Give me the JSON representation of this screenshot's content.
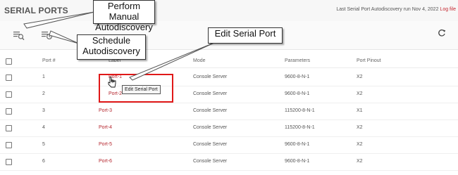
{
  "header": {
    "title": "SERIAL PORTS",
    "last_run_text": "Last Serial Port Autodiscovery run Nov 4, 2022",
    "log_file_link": "Log file"
  },
  "toolbar": {
    "manual_autodiscovery_icon": "manual-discovery-icon",
    "schedule_autodiscovery_icon": "schedule-discovery-icon",
    "refresh_icon": "refresh-icon"
  },
  "table": {
    "columns": [
      "Port #",
      "Label",
      "Mode",
      "Parameters",
      "Port Pinout"
    ],
    "rows": [
      {
        "port": "1",
        "label": "Port-1",
        "mode": "Console Server",
        "parameters": "9600-8-N-1",
        "pinout": "X2"
      },
      {
        "port": "2",
        "label": "Port-2",
        "mode": "Console Server",
        "parameters": "9600-8-N-1",
        "pinout": "X2"
      },
      {
        "port": "3",
        "label": "Port-3",
        "mode": "Console Server",
        "parameters": "115200-8-N-1",
        "pinout": "X1"
      },
      {
        "port": "4",
        "label": "Port-4",
        "mode": "Console Server",
        "parameters": "115200-8-N-1",
        "pinout": "X2"
      },
      {
        "port": "5",
        "label": "Port-5",
        "mode": "Console Server",
        "parameters": "9600-8-N-1",
        "pinout": "X2"
      },
      {
        "port": "6",
        "label": "Port-6",
        "mode": "Console Server",
        "parameters": "9600-8-N-1",
        "pinout": "X2"
      }
    ]
  },
  "tooltip": "Edit Serial Port",
  "callouts": {
    "manual": "Perform Manual Autodiscovery",
    "schedule": "Schedule Autodiscovery",
    "edit": "Edit Serial Port"
  },
  "colors": {
    "link": "#b5262e",
    "highlight": "#e01818"
  }
}
